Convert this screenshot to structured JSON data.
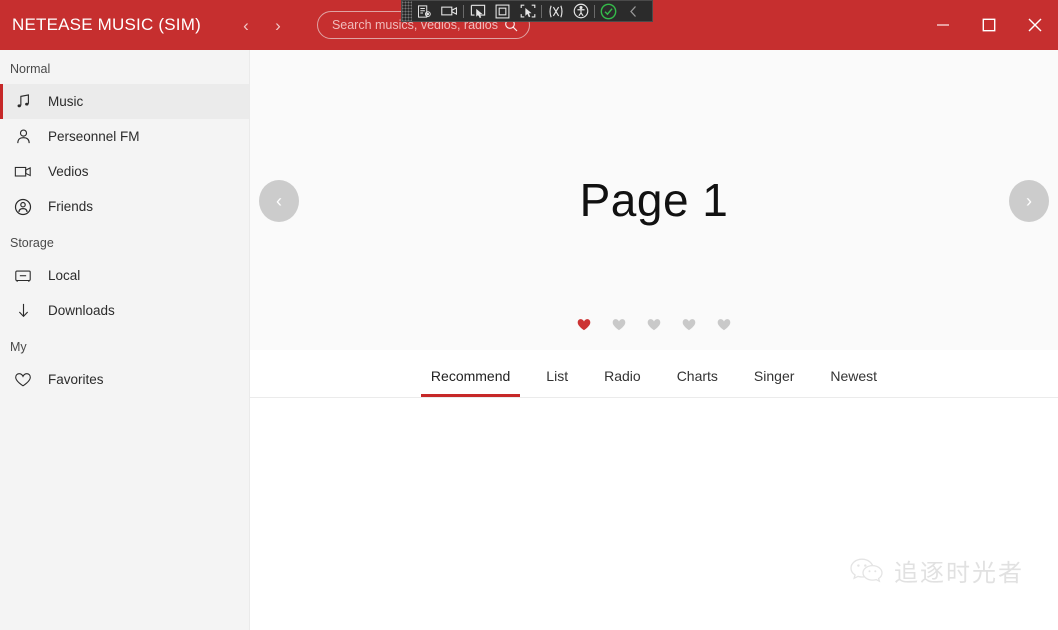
{
  "window": {
    "title": "NETEASE MUSIC (SIM)",
    "accent_red": "#c62f2f",
    "controls": {
      "back_label": "‹",
      "forward_label": "›",
      "minimize_label": "minimize-icon",
      "maximize_label": "maximize-icon",
      "close_label": "close-icon"
    }
  },
  "search": {
    "placeholder": "Search musics, vedios, radios",
    "value": "",
    "icon": "search-icon"
  },
  "capture_toolbar": {
    "items": [
      {
        "name": "capture-settings-icon",
        "title": "Capture settings"
      },
      {
        "name": "record-video-icon",
        "title": "Record video"
      },
      {
        "name": "select-window-icon",
        "title": "Select window"
      },
      {
        "name": "select-screen-icon",
        "title": "Select screen"
      },
      {
        "name": "select-region-icon",
        "title": "Select region"
      },
      {
        "name": "motion-icon",
        "title": "Motion"
      },
      {
        "name": "accessibility-icon",
        "title": "Accessibility"
      },
      {
        "name": "confirm-check-icon",
        "title": "Confirm"
      },
      {
        "name": "collapse-chevron-icon",
        "title": "Collapse"
      }
    ]
  },
  "sidebar": {
    "sections": [
      {
        "label": "Normal",
        "items": [
          {
            "label": "Music",
            "icon": "music-note-icon",
            "active": true
          },
          {
            "label": "Perseonnel FM",
            "icon": "person-icon",
            "active": false
          },
          {
            "label": "Vedios",
            "icon": "video-camera-icon",
            "active": false
          },
          {
            "label": "Friends",
            "icon": "friends-icon",
            "active": false
          }
        ]
      },
      {
        "label": "Storage",
        "items": [
          {
            "label": "Local",
            "icon": "drive-icon",
            "active": false
          },
          {
            "label": "Downloads",
            "icon": "download-arrow-icon",
            "active": false
          }
        ]
      },
      {
        "label": "My",
        "items": [
          {
            "label": "Favorites",
            "icon": "heart-outline-icon",
            "active": false
          }
        ]
      }
    ]
  },
  "banner": {
    "title": "Page 1",
    "prev_label": "‹",
    "next_label": "›",
    "dots": [
      {
        "active": true
      },
      {
        "active": false
      },
      {
        "active": false
      },
      {
        "active": false
      },
      {
        "active": false
      }
    ],
    "active_dot_color": "#cc3333",
    "inactive_dot_color": "#c9c9c9"
  },
  "tabs": {
    "active_index": 0,
    "items": [
      {
        "label": "Recommend"
      },
      {
        "label": "List"
      },
      {
        "label": "Radio"
      },
      {
        "label": "Charts"
      },
      {
        "label": "Singer"
      },
      {
        "label": "Newest"
      }
    ]
  },
  "watermark": {
    "text": "追逐时光者",
    "icon": "wechat-icon"
  }
}
